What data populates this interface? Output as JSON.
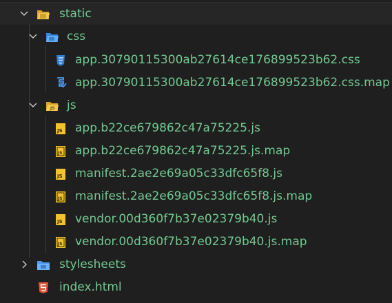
{
  "colors": {
    "background": "#1f1f1f",
    "modified_text": "#73c991",
    "plain_text": "#cccccc",
    "folder_yellow": "#e8b537",
    "folder_blue": "#4c9bef",
    "css_blue": "#4e9bef",
    "js_yellow": "#f2c230",
    "html_red": "#e45534"
  },
  "tree": {
    "static_folder": {
      "label": "static",
      "icon": "folder-open-icon",
      "expanded": true
    },
    "css_folder": {
      "label": "css",
      "icon": "folder-open-icon",
      "expanded": true
    },
    "css_files": [
      {
        "label": "app.30790115300ab27614ce176899523b62.css",
        "icon": "css-file-icon"
      },
      {
        "label": "app.30790115300ab27614ce176899523b62.css.map",
        "icon": "css-map-file-icon"
      }
    ],
    "js_folder": {
      "label": "js",
      "icon": "folder-open-icon",
      "expanded": true
    },
    "js_files": [
      {
        "label": "app.b22ce679862c47a75225.js",
        "icon": "js-file-icon"
      },
      {
        "label": "app.b22ce679862c47a75225.js.map",
        "icon": "js-map-file-icon"
      },
      {
        "label": "manifest.2ae2e69a05c33dfc65f8.js",
        "icon": "js-file-icon"
      },
      {
        "label": "manifest.2ae2e69a05c33dfc65f8.js.map",
        "icon": "js-map-file-icon"
      },
      {
        "label": "vendor.00d360f7b37e02379b40.js",
        "icon": "js-file-icon"
      },
      {
        "label": "vendor.00d360f7b37e02379b40.js.map",
        "icon": "js-map-file-icon"
      }
    ],
    "stylesheets_folder": {
      "label": "stylesheets",
      "icon": "folder-closed-icon",
      "expanded": false
    },
    "index_file": {
      "label": "index.html",
      "icon": "html-file-icon"
    }
  }
}
